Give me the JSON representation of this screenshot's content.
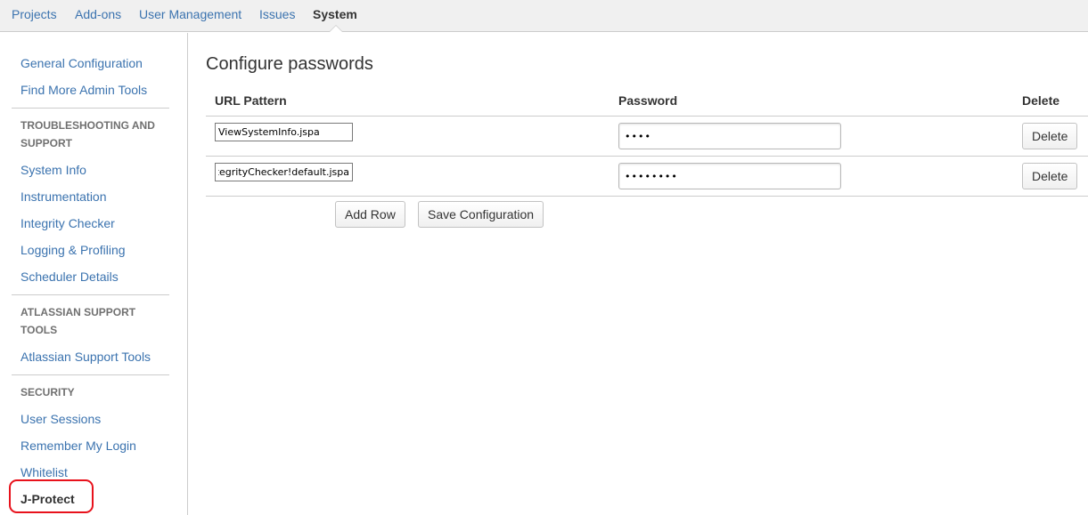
{
  "topnav": {
    "tabs": [
      {
        "label": "Projects"
      },
      {
        "label": "Add-ons"
      },
      {
        "label": "User Management"
      },
      {
        "label": "Issues"
      },
      {
        "label": "System",
        "active": true
      }
    ]
  },
  "sidebar": {
    "top_links": [
      "General Configuration",
      "Find More Admin Tools"
    ],
    "troubleshooting": {
      "heading": "TROUBLESHOOTING AND SUPPORT",
      "links": [
        "System Info",
        "Instrumentation",
        "Integrity Checker",
        "Logging & Profiling",
        "Scheduler Details"
      ]
    },
    "atlassian": {
      "heading": "ATLASSIAN SUPPORT TOOLS",
      "links": [
        "Atlassian Support Tools"
      ]
    },
    "security": {
      "heading": "SECURITY",
      "links": [
        "User Sessions",
        "Remember My Login",
        "Whitelist"
      ],
      "active_link": "J-Protect"
    },
    "highlight_color": "#e8121c"
  },
  "main": {
    "title": "Configure passwords",
    "columns": {
      "url": "URL Pattern",
      "password": "Password",
      "delete": "Delete"
    },
    "rows": [
      {
        "url": "ViewSystemInfo.jspa",
        "password": "1234",
        "delete_label": "Delete"
      },
      {
        "url": "IntegrityChecker!default.jspa",
        "password": "12345678",
        "delete_label": "Delete"
      }
    ],
    "add_row_label": "Add Row",
    "save_label": "Save Configuration"
  },
  "colors": {
    "link": "#3b73af",
    "nav_bg": "#f0f0f0"
  }
}
